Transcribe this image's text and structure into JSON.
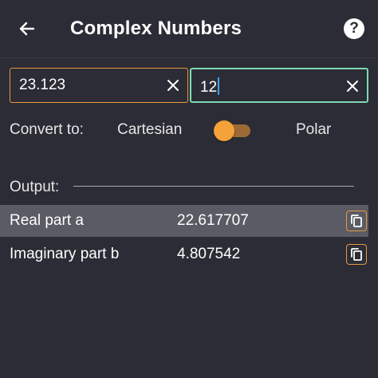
{
  "appbar": {
    "title": "Complex Numbers",
    "back_icon": "arrow-left-icon",
    "help_icon": "help-circle-icon",
    "help_glyph": "?"
  },
  "inputs": {
    "first_value": "23.123",
    "second_value": "12"
  },
  "convert": {
    "label": "Convert to:",
    "option_left": "Cartesian",
    "option_right": "Polar",
    "toggle_on": false
  },
  "output": {
    "label": "Output:",
    "rows": [
      {
        "label": "Real part a",
        "value": "22.617707"
      },
      {
        "label": "Imaginary part b",
        "value": "4.807542"
      }
    ]
  },
  "colors": {
    "background": "#2b2c35",
    "accent_orange": "#f5a23a",
    "focus_green": "#7fd9b0",
    "caret_blue": "#3fa1ff",
    "highlight_row": "#5a5b64"
  }
}
